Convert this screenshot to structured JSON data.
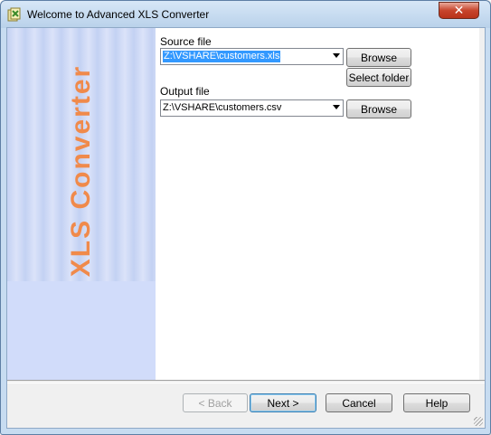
{
  "window": {
    "title": "Welcome to Advanced XLS Converter",
    "close_label": "✕"
  },
  "side_panel": {
    "title": "XLS Converter"
  },
  "source": {
    "label": "Source file",
    "value": "Z:\\VSHARE\\customers.xls",
    "browse_label": "Browse",
    "select_folder_label": "Select folder"
  },
  "output": {
    "label": "Output file",
    "value": "Z:\\VSHARE\\customers.csv",
    "browse_label": "Browse"
  },
  "footer": {
    "back_label": "< Back",
    "next_label": "Next >",
    "cancel_label": "Cancel",
    "help_label": "Help"
  },
  "colors": {
    "side_title": "#f08a4b",
    "selection": "#3399ff",
    "close_button": "#c7452c"
  }
}
